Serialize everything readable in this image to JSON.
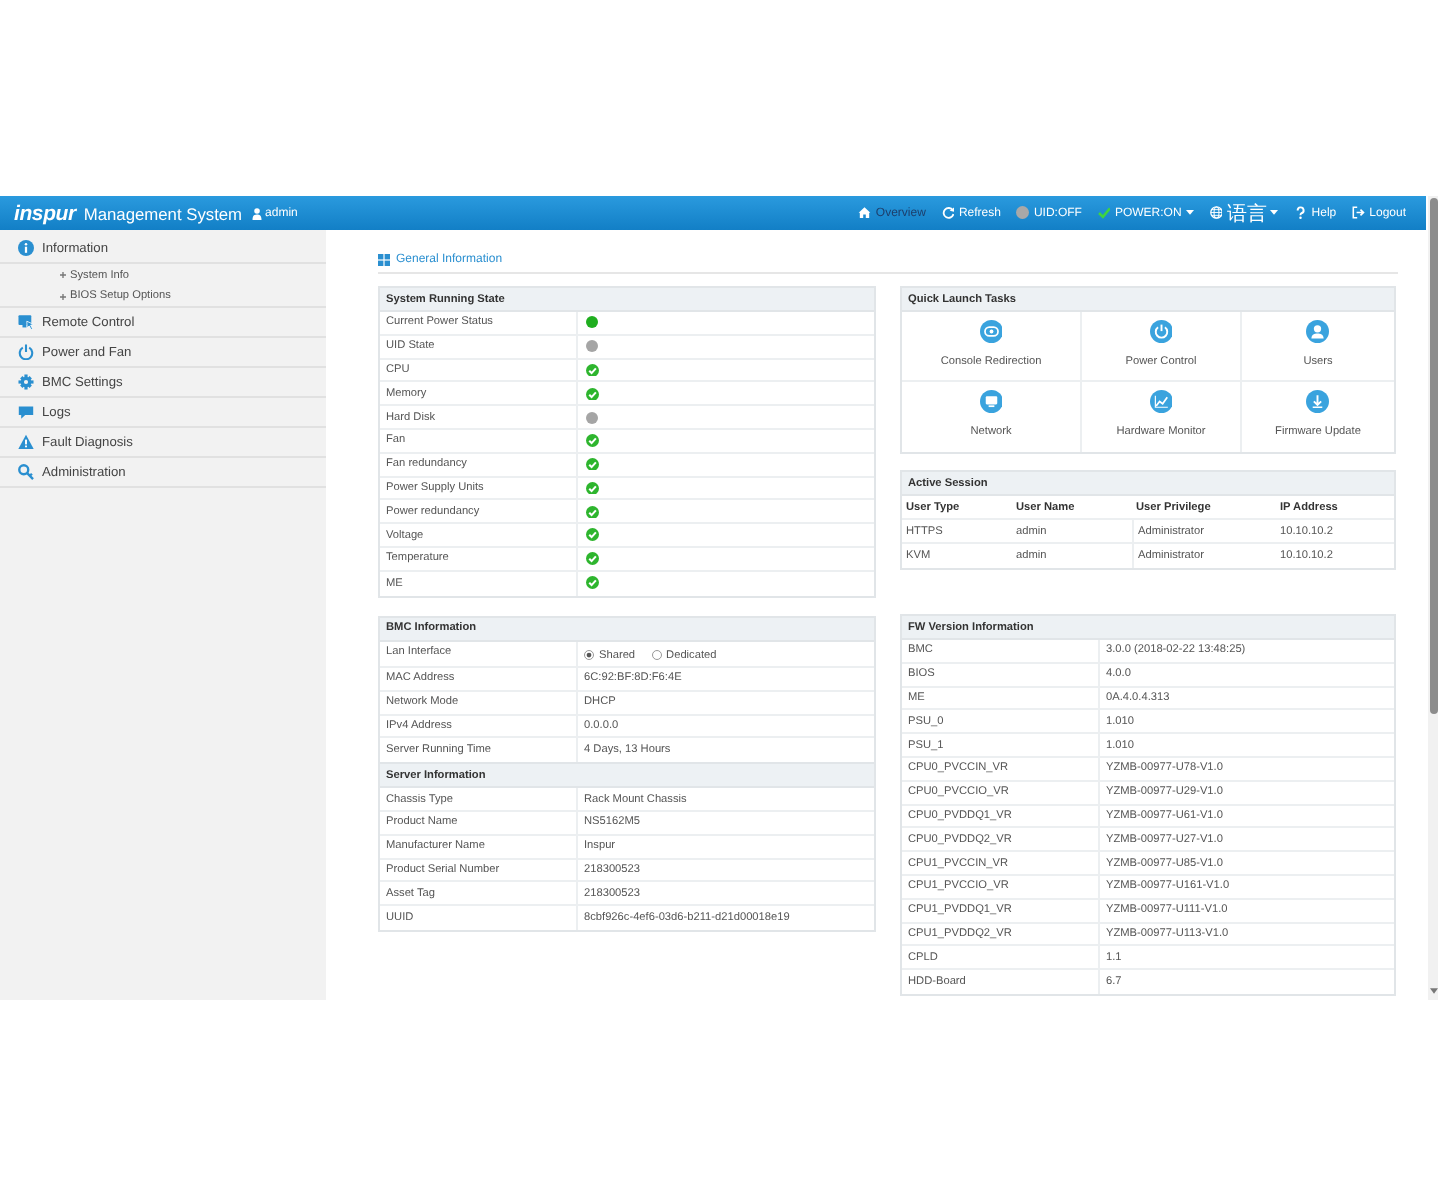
{
  "header": {
    "logo": "inspur",
    "title": "Management System",
    "user": "admin",
    "nav": [
      {
        "kind": "home",
        "label": "Overview",
        "selected": true,
        "dropdown": false
      },
      {
        "kind": "refresh",
        "label": "Refresh",
        "selected": false,
        "dropdown": false
      },
      {
        "kind": "uid",
        "label": "UID:OFF",
        "selected": false,
        "dropdown": false
      },
      {
        "kind": "power",
        "label": "POWER:ON",
        "selected": false,
        "dropdown": true
      },
      {
        "kind": "language",
        "label": "语言",
        "selected": false,
        "dropdown": true
      },
      {
        "kind": "help",
        "label": "Help",
        "selected": false,
        "dropdown": false
      },
      {
        "kind": "logout",
        "label": "Logout",
        "selected": false,
        "dropdown": false
      }
    ]
  },
  "sidebar": {
    "items": [
      {
        "kind": "info",
        "label": "Information",
        "children": [
          {
            "label": "System Info"
          },
          {
            "label": "BIOS Setup Options"
          }
        ]
      },
      {
        "kind": "remote",
        "label": "Remote Control"
      },
      {
        "kind": "power",
        "label": "Power and Fan"
      },
      {
        "kind": "settings",
        "label": "BMC Settings"
      },
      {
        "kind": "logs",
        "label": "Logs"
      },
      {
        "kind": "fault",
        "label": "Fault Diagnosis"
      },
      {
        "kind": "admin",
        "label": "Administration"
      }
    ]
  },
  "page": {
    "title": "General Information"
  },
  "system_running_state": {
    "title": "System Running State",
    "rows": [
      {
        "label": "Current Power Status",
        "kind": "power_on"
      },
      {
        "label": "UID State",
        "kind": "inactive"
      },
      {
        "label": "CPU",
        "kind": "ok"
      },
      {
        "label": "Memory",
        "kind": "ok"
      },
      {
        "label": "Hard Disk",
        "kind": "inactive"
      },
      {
        "label": "Fan",
        "kind": "ok"
      },
      {
        "label": "Fan redundancy",
        "kind": "ok"
      },
      {
        "label": "Power Supply Units",
        "kind": "ok"
      },
      {
        "label": "Power redundancy",
        "kind": "ok"
      },
      {
        "label": "Voltage",
        "kind": "ok"
      },
      {
        "label": "Temperature",
        "kind": "ok"
      },
      {
        "label": "ME",
        "kind": "ok"
      }
    ]
  },
  "bmc_information": {
    "title": "BMC Information",
    "lan_interface": {
      "label": "Lan Interface",
      "options": [
        {
          "label": "Shared",
          "selected": true
        },
        {
          "label": "Dedicated",
          "selected": false
        }
      ]
    },
    "rows": [
      {
        "label": "MAC Address",
        "value": "6C:92:BF:8D:F6:4E"
      },
      {
        "label": "Network Mode",
        "value": "DHCP"
      },
      {
        "label": "IPv4 Address",
        "value": "0.0.0.0"
      },
      {
        "label": "Server Running Time",
        "value": "4 Days, 13 Hours"
      }
    ]
  },
  "server_information": {
    "title": "Server Information",
    "rows": [
      {
        "label": "Chassis Type",
        "value": "Rack Mount Chassis"
      },
      {
        "label": "Product Name",
        "value": "NS5162M5"
      },
      {
        "label": "Manufacturer Name",
        "value": "Inspur"
      },
      {
        "label": "Product Serial Number",
        "value": "218300523"
      },
      {
        "label": "Asset Tag",
        "value": "218300523"
      },
      {
        "label": "UUID",
        "value": "8cbf926c-4ef6-03d6-b211-d21d00018e19"
      }
    ]
  },
  "quick_launch_tasks": {
    "title": "Quick Launch Tasks",
    "tasks": [
      {
        "kind": "console",
        "label": "Console Redirection"
      },
      {
        "kind": "power",
        "label": "Power Control"
      },
      {
        "kind": "users",
        "label": "Users"
      },
      {
        "kind": "network",
        "label": "Network"
      },
      {
        "kind": "monitor",
        "label": "Hardware Monitor"
      },
      {
        "kind": "firmware",
        "label": "Firmware Update"
      }
    ]
  },
  "active_session": {
    "title": "Active Session",
    "columns": [
      "User Type",
      "User Name",
      "User Privilege",
      "IP Address"
    ],
    "rows": [
      [
        "HTTPS",
        "admin",
        "Administrator",
        "10.10.10.2"
      ],
      [
        "KVM",
        "admin",
        "Administrator",
        "10.10.10.2"
      ]
    ]
  },
  "fw_version_information": {
    "title": "FW Version Information",
    "rows": [
      {
        "label": "BMC",
        "value": "3.0.0 (2018-02-22 13:48:25)"
      },
      {
        "label": "BIOS",
        "value": "4.0.0"
      },
      {
        "label": "ME",
        "value": "0A.4.0.4.313"
      },
      {
        "label": "PSU_0",
        "value": "1.010"
      },
      {
        "label": "PSU_1",
        "value": "1.010"
      },
      {
        "label": "CPU0_PVCCIN_VR",
        "value": "YZMB-00977-U78-V1.0"
      },
      {
        "label": "CPU0_PVCCIO_VR",
        "value": "YZMB-00977-U29-V1.0"
      },
      {
        "label": "CPU0_PVDDQ1_VR",
        "value": "YZMB-00977-U61-V1.0"
      },
      {
        "label": "CPU0_PVDDQ2_VR",
        "value": "YZMB-00977-U27-V1.0"
      },
      {
        "label": "CPU1_PVCCIN_VR",
        "value": "YZMB-00977-U85-V1.0"
      },
      {
        "label": "CPU1_PVCCIO_VR",
        "value": "YZMB-00977-U161-V1.0"
      },
      {
        "label": "CPU1_PVDDQ1_VR",
        "value": "YZMB-00977-U111-V1.0"
      },
      {
        "label": "CPU1_PVDDQ2_VR",
        "value": "YZMB-00977-U113-V1.0"
      },
      {
        "label": "CPLD",
        "value": "1.1"
      },
      {
        "label": "HDD-Board",
        "value": "6.7"
      }
    ]
  }
}
